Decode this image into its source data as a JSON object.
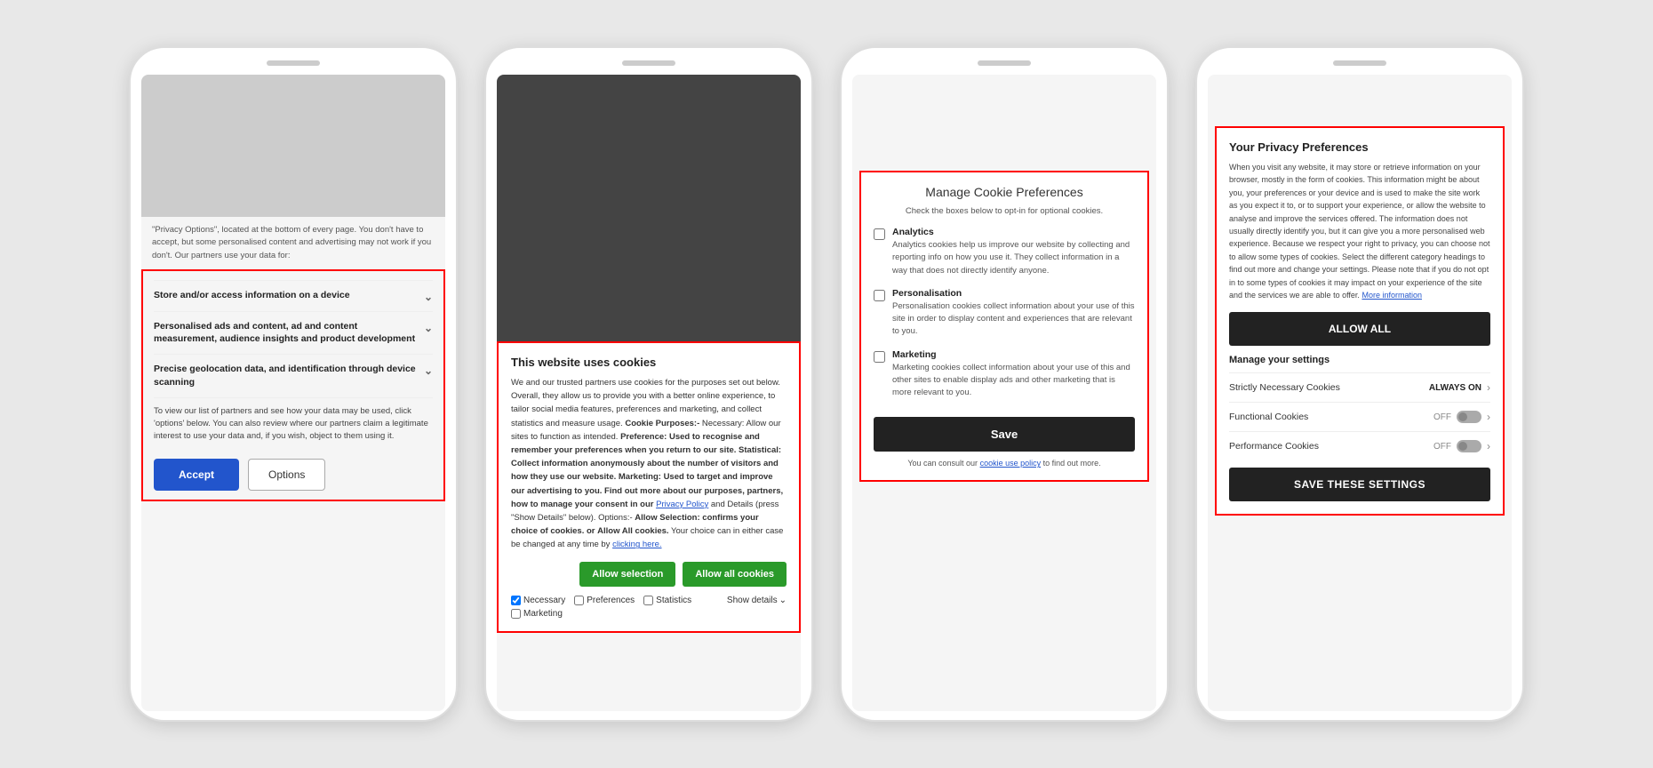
{
  "phone1": {
    "above_text": "\"Privacy Options\", located at the bottom of every page. You don't have to accept, but some personalised content and advertising may not work if you don't. Our partners use your data for:",
    "item1_label": "Store and/or access information on a device",
    "item2_label": "Personalised ads and content, ad and content measurement, audience insights and product development",
    "item3_label": "Precise geolocation data, and identification through device scanning",
    "bottom_text": "To view our list of partners and see how your data may be used, click 'options' below. You can also review where our partners claim a legitimate interest to use your data and, if you wish, object to them using it.",
    "accept_label": "Accept",
    "options_label": "Options"
  },
  "phone2": {
    "title": "This website uses cookies",
    "body_intro": "We and our trusted partners use cookies for the purposes set out below. Overall, they allow us to provide you with a better online experience, to tailor social media features, preferences and marketing, and collect statistics and measure usage.",
    "bold_purposes": "Cookie Purposes:-",
    "necessary_text": "Necessary: Allow our sites to function as intended.",
    "preference_text": "Preference: Used to recognise and remember your preferences when you return to our site.",
    "statistical_text": "Statistical: Collect information anonymously about the number of visitors and how they use our website.",
    "marketing_text": "Marketing: Used to target and improve our advertising to you. Find out more about our purposes, partners, how to manage your consent in our",
    "privacy_policy_link": "Privacy Policy",
    "details_text": "and Details (press \"Show Details\" below). Options:-",
    "allow_selection_text": "Allow Selection: confirms your choice of cookies. or",
    "allow_all_text": "Allow All cookies.",
    "choice_text": "Your choice can in either case be changed at any time by",
    "clicking_here_link": "clicking here.",
    "btn_allow_selection": "Allow selection",
    "btn_allow_all_cookies": "Allow all cookies",
    "check_necessary": "Necessary",
    "check_preferences": "Preferences",
    "check_statistics": "Statistics",
    "check_marketing": "Marketing",
    "show_details": "Show details"
  },
  "phone3": {
    "title": "Manage Cookie Preferences",
    "subtitle": "Check the boxes below to opt-in for optional cookies.",
    "option1_label": "Analytics",
    "option1_desc": "Analytics cookies help us improve our website by collecting and reporting info on how you use it. They collect information in a way that does not directly identify anyone.",
    "option2_label": "Personalisation",
    "option2_desc": "Personalisation cookies collect information about your use of this site in order to display content and experiences that are relevant to you.",
    "option3_label": "Marketing",
    "option3_desc": "Marketing cookies collect information about your use of this and other sites to enable display ads and other marketing that is more relevant to you.",
    "btn_save": "Save",
    "consult_text": "You can consult our",
    "cookie_policy_link": "cookie use policy",
    "consult_end": "to find out more."
  },
  "phone4": {
    "title": "Your Privacy Preferences",
    "body_text": "When you visit any website, it may store or retrieve information on your browser, mostly in the form of cookies. This information might be about you, your preferences or your device and is used to make the site work as you expect it to, or to support your experience, or allow the website to analyse and improve the services offered. The information does not usually directly identify you, but it can give you a more personalised web experience. Because we respect your right to privacy, you can choose not to allow some types of cookies. Select the different category headings to find out more and change your settings. Please note that if you do not opt in to some types of cookies it may impact on your experience of the site and the services we are able to offer.",
    "more_info_link": "More information",
    "btn_allow_all": "ALLOW ALL",
    "manage_title": "Manage your settings",
    "row1_label": "Strictly Necessary Cookies",
    "row1_status": "ALWAYS ON",
    "row2_label": "Functional Cookies",
    "row2_status": "OFF",
    "row3_label": "Performance Cookies",
    "row3_status": "OFF",
    "btn_save_settings": "SAVE THESE SETTINGS"
  }
}
